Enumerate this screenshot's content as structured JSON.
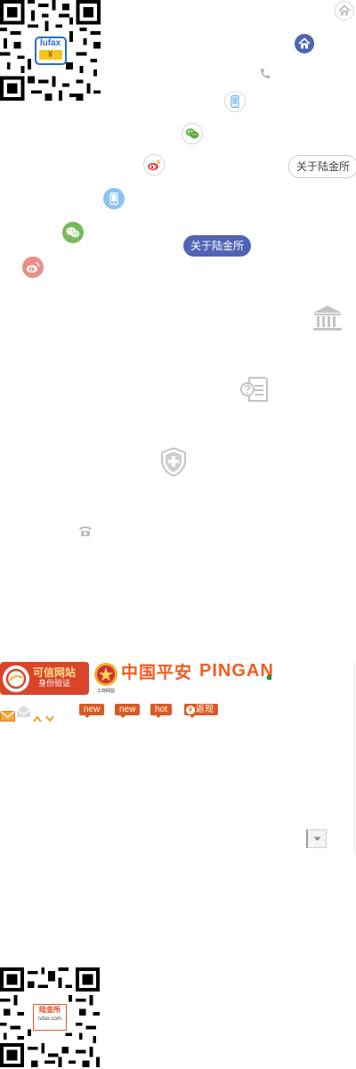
{
  "qr_top": {
    "badge_text": "lufax",
    "badge_symbol": "¥"
  },
  "nav_links": {
    "about_outline": "关于陆金所",
    "about_filled": "关于陆金所"
  },
  "icons": {
    "home_outline": "home-icon",
    "home_filled": "home-icon",
    "phone": "phone-icon",
    "mobile": "mobile-icon",
    "wechat": "wechat-icon",
    "weibo": "weibo-icon",
    "bank": "bank-icon",
    "help_doc": "help-document-icon",
    "security_shield": "shield-plus-icon",
    "telephone": "telephone-icon",
    "mail": "mail-icon",
    "chevron_up": "chevron-up-icon",
    "chevron_down": "chevron-down-icon"
  },
  "footer": {
    "credit_badge": {
      "line1": "可信网站",
      "line2": "身份验证"
    },
    "gongshang_label": "工商网监",
    "pingan_cn": "中国平安",
    "pingan_en": "PINGAN",
    "tags": [
      "new",
      "new",
      "hot",
      "返现"
    ]
  },
  "qr_bottom": {
    "badge_text": "陆金所",
    "badge_sub": "lufax.com"
  },
  "colors": {
    "accent_blue": "#5064b5",
    "brand_orange": "#f25b1e",
    "badge_red": "#d9452b",
    "wechat_green": "#55b03f",
    "weibo_red": "#e0534a",
    "mobile_blue": "#4ea4e6"
  }
}
